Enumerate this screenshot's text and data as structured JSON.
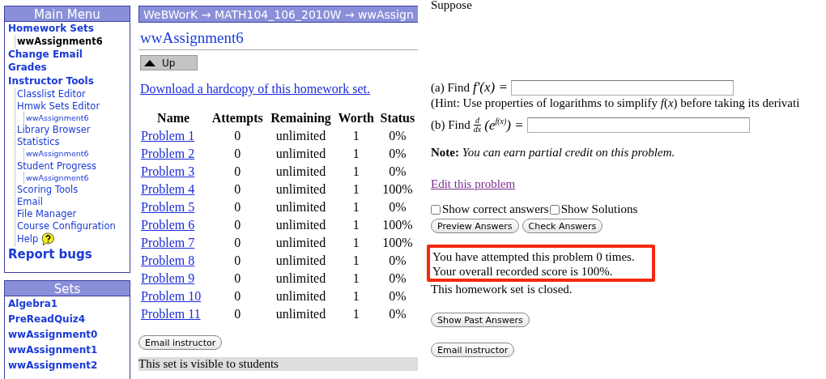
{
  "main_menu": {
    "title": "Main Menu",
    "items": [
      {
        "label": "Homework Sets",
        "selected": false,
        "children": [
          {
            "label": "wwAssignment6",
            "selected": true
          }
        ]
      },
      {
        "label": "Change Email",
        "selected": false
      },
      {
        "label": "Grades",
        "selected": false
      },
      {
        "label": "Instructor Tools",
        "selected": false,
        "children": [
          {
            "label": "Classlist Editor",
            "kind": "link",
            "selected": false
          },
          {
            "label": "Hmwk Sets Editor",
            "kind": "link",
            "selected": false,
            "children": [
              {
                "label": "wwAssignment6",
                "selected": false
              }
            ]
          },
          {
            "label": "Library Browser",
            "kind": "link",
            "selected": false
          },
          {
            "label": "Statistics",
            "kind": "link",
            "selected": false,
            "children": [
              {
                "label": "wwAssignment6",
                "selected": false
              }
            ]
          },
          {
            "label": "Student Progress",
            "kind": "link",
            "selected": false,
            "children": [
              {
                "label": "wwAssignment6",
                "selected": false
              }
            ]
          },
          {
            "label": "Scoring Tools",
            "kind": "link",
            "selected": false
          },
          {
            "label": "Email",
            "kind": "link",
            "selected": false
          },
          {
            "label": "File Manager",
            "kind": "link",
            "selected": false
          },
          {
            "label": "Course Configuration",
            "kind": "link",
            "selected": false
          },
          {
            "label": "Help",
            "kind": "help",
            "selected": false
          }
        ]
      }
    ],
    "report_link": "Report bugs"
  },
  "sets": {
    "title": "Sets",
    "items": [
      "Algebra1",
      "PreReadQuiz4",
      "wwAssignment0",
      "wwAssignment1",
      "wwAssignment2"
    ]
  },
  "breadcrumb": "WeBWorK → MATH104_106_2010W → wwAssign",
  "set_title": "wwAssignment6",
  "up_button": "Up",
  "hardcopy_link": "Download a hardcopy of this homework set.",
  "problems_table": {
    "columns": [
      "Name",
      "Attempts",
      "Remaining",
      "Worth",
      "Status"
    ],
    "rows": [
      [
        "Problem 1",
        "0",
        "unlimited",
        "1",
        "0%"
      ],
      [
        "Problem 2",
        "0",
        "unlimited",
        "1",
        "0%"
      ],
      [
        "Problem 3",
        "0",
        "unlimited",
        "1",
        "0%"
      ],
      [
        "Problem 4",
        "0",
        "unlimited",
        "1",
        "100%"
      ],
      [
        "Problem 5",
        "0",
        "unlimited",
        "1",
        "0%"
      ],
      [
        "Problem 6",
        "0",
        "unlimited",
        "1",
        "100%"
      ],
      [
        "Problem 7",
        "0",
        "unlimited",
        "1",
        "100%"
      ],
      [
        "Problem 8",
        "0",
        "unlimited",
        "1",
        "0%"
      ],
      [
        "Problem 9",
        "0",
        "unlimited",
        "1",
        "0%"
      ],
      [
        "Problem 10",
        "0",
        "unlimited",
        "1",
        "0%"
      ],
      [
        "Problem 11",
        "0",
        "unlimited",
        "1",
        "0%"
      ]
    ]
  },
  "email_button_left": "Email instructor",
  "visibility_note": "This set is visible to students",
  "problem": {
    "intro": "Suppose",
    "part_a": {
      "label": "(a) Find",
      "math": "f′(x) ="
    },
    "hint": "(Hint: Use properties of logarithms to simplify *f*(*x*) before taking its derivati",
    "part_b": {
      "label": "(b) Find",
      "numerator": "d",
      "denominator": "dx",
      "open_paren": "(",
      "close_paren": ")",
      "base": "e",
      "exponent": "f(x)",
      "equals": "="
    },
    "note_label": "Note:",
    "note_text": "You can earn partial credit on this problem.",
    "edit_link": "Edit this problem",
    "checkboxes": [
      {
        "label": "Show correct answers",
        "checked": false
      },
      {
        "label": "Show Solutions",
        "checked": false
      }
    ],
    "buttons": [
      "Preview Answers",
      "Check Answers"
    ],
    "attempt_message": [
      "You have attempted this problem 0 times.",
      "Your overall recorded score is 100%."
    ],
    "closed_message": "This homework set is closed.",
    "past_answers_button": "Show Past Answers",
    "email_button": "Email instructor"
  }
}
